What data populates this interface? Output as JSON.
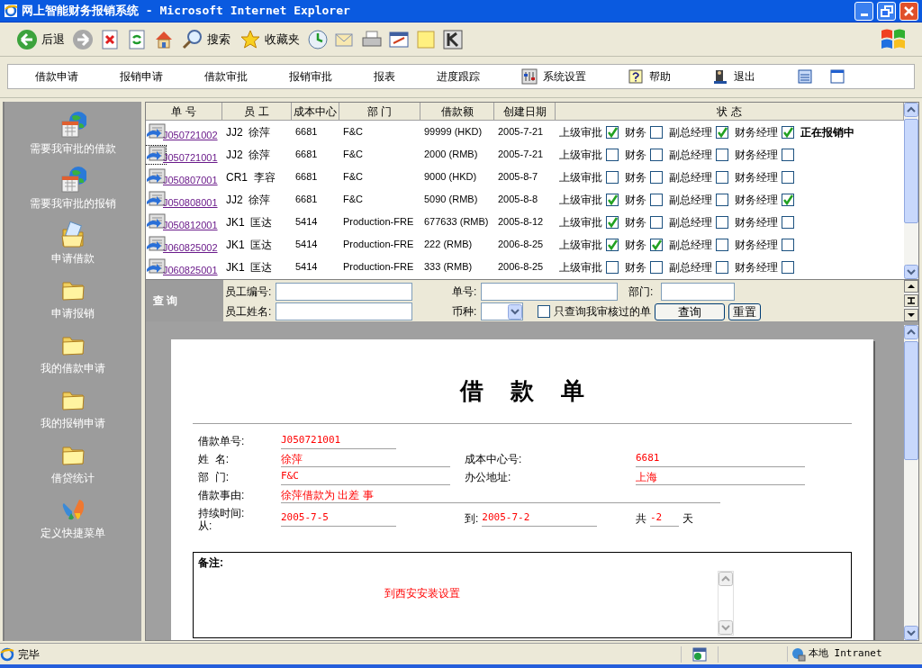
{
  "window": {
    "title": "网上智能财务报销系统 - Microsoft Internet Explorer"
  },
  "toolbar": [
    {
      "kind": "back",
      "label": "后退"
    },
    {
      "kind": "forward"
    },
    {
      "kind": "stop"
    },
    {
      "kind": "refresh"
    },
    {
      "kind": "home"
    },
    {
      "kind": "search",
      "label": "搜索"
    },
    {
      "kind": "favorites",
      "label": "收藏夹"
    },
    {
      "kind": "history"
    },
    {
      "kind": "mail"
    },
    {
      "kind": "print"
    },
    {
      "kind": "edit"
    },
    {
      "kind": "note"
    },
    {
      "kind": "k"
    }
  ],
  "menu": [
    {
      "label": "借款申请"
    },
    {
      "label": "报销申请"
    },
    {
      "label": "借款审批"
    },
    {
      "label": "报销审批"
    },
    {
      "label": "报表"
    },
    {
      "label": "进度跟踪"
    },
    {
      "label": "系统设置",
      "kind": "settings"
    },
    {
      "label": "帮助",
      "kind": "help"
    },
    {
      "label": "退出",
      "kind": "exit"
    },
    {
      "kind": "list"
    },
    {
      "kind": "window"
    }
  ],
  "sidebar": {
    "items": [
      {
        "label": "需要我审批的借款",
        "kind": "calendar"
      },
      {
        "label": "需要我审批的报销",
        "kind": "calendar"
      },
      {
        "label": "申请借款",
        "kind": "open-folder"
      },
      {
        "label": "申请报销",
        "kind": "folder"
      },
      {
        "label": "我的借款申请",
        "kind": "folder"
      },
      {
        "label": "我的报销申请",
        "kind": "folder"
      },
      {
        "label": "借贷统计",
        "kind": "folder"
      },
      {
        "label": "定义快捷菜单",
        "kind": "butterfly"
      }
    ]
  },
  "table": {
    "columns": [
      "单 号",
      "员 工",
      "成本中心",
      "部 门",
      "借款额",
      "创建日期",
      "状 态"
    ],
    "rows": [
      {
        "number": "J050721002",
        "focused": false,
        "employee": "JJ2  徐萍",
        "cost_center": "6681",
        "department": "F&C",
        "amount": "99999 (HKD)",
        "created": "2005-7-21",
        "approvals": [
          {
            "label": "上级审批",
            "checked": true
          },
          {
            "label": "财务",
            "checked": false
          },
          {
            "label": "副总经理",
            "checked": true
          },
          {
            "label": "财务经理",
            "checked": true
          }
        ],
        "status_text": "正在报销中"
      },
      {
        "number": "J050721001",
        "focused": true,
        "employee": "JJ2  徐萍",
        "cost_center": "6681",
        "department": "F&C",
        "amount": "2000 (RMB)",
        "created": "2005-7-21",
        "approvals": [
          {
            "label": "上级审批",
            "checked": false
          },
          {
            "label": "财务",
            "checked": false
          },
          {
            "label": "副总经理",
            "checked": false
          },
          {
            "label": "财务经理",
            "checked": false
          }
        ]
      },
      {
        "number": "J050807001",
        "focused": false,
        "employee": "CR1  李容",
        "cost_center": "6681",
        "department": "F&C",
        "amount": "9000 (HKD)",
        "created": "2005-8-7",
        "approvals": [
          {
            "label": "上级审批",
            "checked": false
          },
          {
            "label": "财务",
            "checked": false
          },
          {
            "label": "副总经理",
            "checked": false
          },
          {
            "label": "财务经理",
            "checked": false
          }
        ]
      },
      {
        "number": "J050808001",
        "focused": false,
        "employee": "JJ2  徐萍",
        "cost_center": "6681",
        "department": "F&C",
        "amount": "5090 (RMB)",
        "created": "2005-8-8",
        "approvals": [
          {
            "label": "上级审批",
            "checked": true
          },
          {
            "label": "财务",
            "checked": false
          },
          {
            "label": "副总经理",
            "checked": false
          },
          {
            "label": "财务经理",
            "checked": true
          }
        ]
      },
      {
        "number": "J050812001",
        "focused": false,
        "employee": "JK1  匡达",
        "cost_center": "5414",
        "department": "Production-FRE",
        "amount": "677633 (RMB)",
        "created": "2005-8-12",
        "approvals": [
          {
            "label": "上级审批",
            "checked": true
          },
          {
            "label": "财务",
            "checked": false
          },
          {
            "label": "副总经理",
            "checked": false
          },
          {
            "label": "财务经理",
            "checked": false
          }
        ]
      },
      {
        "number": "J060825002",
        "focused": false,
        "employee": "JK1  匡达",
        "cost_center": "5414",
        "department": "Production-FRE",
        "amount": "222 (RMB)",
        "created": "2006-8-25",
        "approvals": [
          {
            "label": "上级审批",
            "checked": true
          },
          {
            "label": "财务",
            "checked": true
          },
          {
            "label": "副总经理",
            "checked": false
          },
          {
            "label": "财务经理",
            "checked": false
          }
        ]
      },
      {
        "number": "J060825001",
        "focused": false,
        "employee": "JK1  匡达",
        "cost_center": "5414",
        "department": "Production-FRE",
        "amount": "333 (RMB)",
        "created": "2006-8-25",
        "approvals": [
          {
            "label": "上级审批",
            "checked": false
          },
          {
            "label": "财务",
            "checked": false
          },
          {
            "label": "副总经理",
            "checked": false
          },
          {
            "label": "财务经理",
            "checked": false
          }
        ]
      }
    ]
  },
  "query": {
    "title": "查 询",
    "employee_id_label": "员工编号:",
    "number_label": "单号:",
    "department_label": "部门:",
    "employee_name_label": "员工姓名:",
    "currency_label": "币种:",
    "only_mine": {
      "label": "只查询我审核过的单",
      "checked": false
    },
    "buttons": [
      "查询",
      "重置"
    ]
  },
  "form": {
    "title": "借款单",
    "number": {
      "label": "借款单号:",
      "value": "J050721001"
    },
    "name": {
      "label": "姓  名:",
      "value": "徐萍"
    },
    "cost_center": {
      "label": "成本中心号:",
      "value": "6681"
    },
    "department": {
      "label": "部  门:",
      "value": "F&C"
    },
    "office": {
      "label": "办公地址:",
      "value": "上海"
    },
    "reason": {
      "label": "借款事由:",
      "value": "徐萍借款为 出差 事"
    },
    "duration_label": "持续时间:",
    "from": {
      "label": "从:",
      "value": "2005-7-5"
    },
    "to": {
      "label": "到:",
      "value": "2005-7-2"
    },
    "days": {
      "label": "共",
      "value": "-2",
      "unit": "天"
    },
    "remarks": {
      "label": "备注:",
      "value": "到西安安装设置"
    }
  },
  "status_bar": {
    "text": "完毕",
    "zone": "本地 Intranet"
  }
}
